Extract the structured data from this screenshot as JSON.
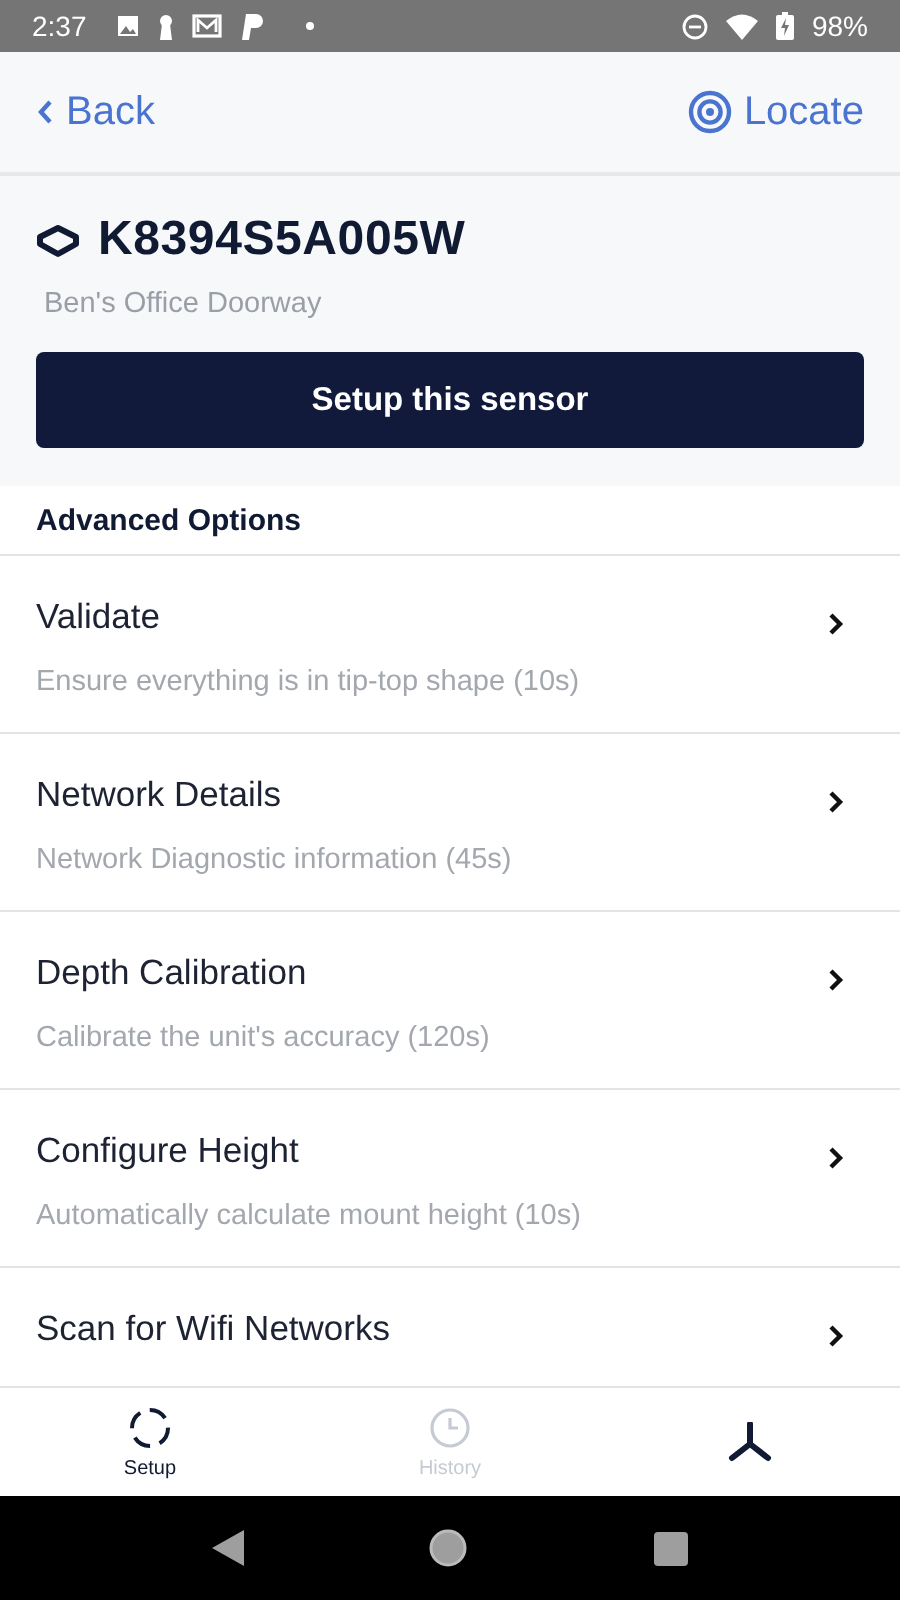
{
  "status_bar": {
    "time": "2:37",
    "battery": "98%"
  },
  "header": {
    "back": "Back",
    "locate": "Locate"
  },
  "sensor": {
    "id": "K8394S5A005W",
    "location": "Ben's Office Doorway",
    "setup_button": "Setup this sensor"
  },
  "advanced": {
    "title": "Advanced Options",
    "items": [
      {
        "title": "Validate",
        "subtitle": "Ensure everything is in tip-top shape (10s)"
      },
      {
        "title": "Network Details",
        "subtitle": "Network Diagnostic information (45s)"
      },
      {
        "title": "Depth Calibration",
        "subtitle": "Calibrate the unit's accuracy (120s)"
      },
      {
        "title": "Configure Height",
        "subtitle": "Automatically calculate mount height (10s)"
      },
      {
        "title": "Scan for Wifi Networks"
      }
    ]
  },
  "tabs": [
    {
      "label": "Setup",
      "selected": true
    },
    {
      "label": "History",
      "selected": false
    }
  ]
}
